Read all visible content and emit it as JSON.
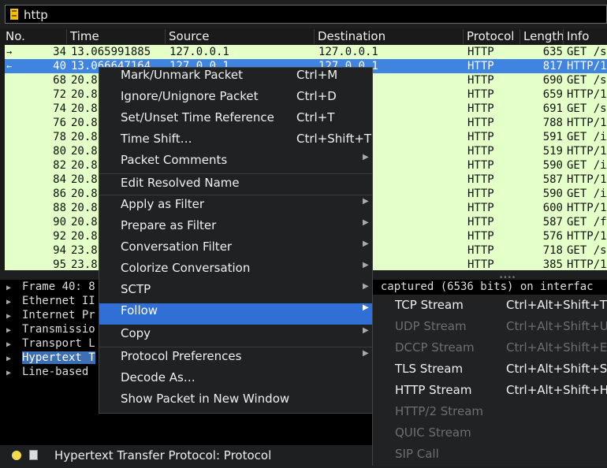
{
  "filter": {
    "value": "http",
    "icon": "bookmark-icon"
  },
  "columns": [
    "No.",
    "Time",
    "Source",
    "Destination",
    "Protocol",
    "Length",
    "Info"
  ],
  "packets": [
    {
      "no": "34",
      "time": "13.065991885",
      "src": "127.0.0.1",
      "dst": "127.0.0.1",
      "proto": "HTTP",
      "len": "635",
      "info": "GET /s"
    },
    {
      "no": "40",
      "time": "13.066647164",
      "src": "127.0.0.1",
      "dst": "127.0.0.1",
      "proto": "HTTP",
      "len": "817",
      "info": "HTTP/1"
    },
    {
      "no": "68",
      "time": "20.8",
      "src": "",
      "dst": "1",
      "proto": "HTTP",
      "len": "690",
      "info": "GET /s"
    },
    {
      "no": "72",
      "time": "20.8",
      "src": "",
      "dst": "1",
      "proto": "HTTP",
      "len": "659",
      "info": "HTTP/1"
    },
    {
      "no": "74",
      "time": "20.8",
      "src": "",
      "dst": "1",
      "proto": "HTTP",
      "len": "691",
      "info": "GET /s"
    },
    {
      "no": "76",
      "time": "20.8",
      "src": "",
      "dst": "1",
      "proto": "HTTP",
      "len": "788",
      "info": "HTTP/1"
    },
    {
      "no": "78",
      "time": "20.8",
      "src": "",
      "dst": "1",
      "proto": "HTTP",
      "len": "591",
      "info": "GET /i"
    },
    {
      "no": "80",
      "time": "20.8",
      "src": "",
      "dst": "1",
      "proto": "HTTP",
      "len": "519",
      "info": "HTTP/1"
    },
    {
      "no": "82",
      "time": "20.8",
      "src": "",
      "dst": "1",
      "proto": "HTTP",
      "len": "590",
      "info": "GET /i"
    },
    {
      "no": "84",
      "time": "20.8",
      "src": "",
      "dst": "1",
      "proto": "HTTP",
      "len": "587",
      "info": "HTTP/1"
    },
    {
      "no": "86",
      "time": "20.8",
      "src": "",
      "dst": "1",
      "proto": "HTTP",
      "len": "590",
      "info": "GET /i"
    },
    {
      "no": "88",
      "time": "20.8",
      "src": "",
      "dst": "1",
      "proto": "HTTP",
      "len": "600",
      "info": "HTTP/1"
    },
    {
      "no": "90",
      "time": "20.8",
      "src": "",
      "dst": "1",
      "proto": "HTTP",
      "len": "587",
      "info": "GET /f"
    },
    {
      "no": "92",
      "time": "20.8",
      "src": "",
      "dst": "1",
      "proto": "HTTP",
      "len": "576",
      "info": "HTTP/1"
    },
    {
      "no": "94",
      "time": "23.8",
      "src": "",
      "dst": "1",
      "proto": "HTTP",
      "len": "718",
      "info": "GET /s"
    },
    {
      "no": "95",
      "time": "23.8",
      "src": "",
      "dst": "1",
      "proto": "HTTP",
      "len": "385",
      "info": "HTTP/1"
    }
  ],
  "details": [
    {
      "text": "Frame 40: 8",
      "tail": "s captured (6536 bits) on interfac"
    },
    {
      "text": "Ethernet II",
      "tail": ""
    },
    {
      "text": "Internet Pr",
      "tail": ""
    },
    {
      "text": "Transmissio",
      "tail": ""
    },
    {
      "text": "Transport L",
      "tail": ""
    },
    {
      "text": "Hypertext T",
      "tail": ""
    },
    {
      "text": "Line-based",
      "tail": ""
    }
  ],
  "context_menu": [
    {
      "label": "Mark/Unmark Packet",
      "shortcut": "Ctrl+M",
      "submenu": false
    },
    {
      "label": "Ignore/Unignore Packet",
      "shortcut": "Ctrl+D",
      "submenu": false
    },
    {
      "label": "Set/Unset Time Reference",
      "shortcut": "Ctrl+T",
      "submenu": false
    },
    {
      "label": "Time Shift…",
      "shortcut": "Ctrl+Shift+T",
      "submenu": false
    },
    {
      "label": "Packet Comments",
      "shortcut": "",
      "submenu": true
    },
    {
      "label": "Edit Resolved Name",
      "shortcut": "",
      "submenu": false
    },
    {
      "label": "Apply as Filter",
      "shortcut": "",
      "submenu": true
    },
    {
      "label": "Prepare as Filter",
      "shortcut": "",
      "submenu": true
    },
    {
      "label": "Conversation Filter",
      "shortcut": "",
      "submenu": true
    },
    {
      "label": "Colorize Conversation",
      "shortcut": "",
      "submenu": true
    },
    {
      "label": "SCTP",
      "shortcut": "",
      "submenu": true
    },
    {
      "label": "Follow",
      "shortcut": "",
      "submenu": true,
      "active": true
    },
    {
      "label": "Copy",
      "shortcut": "",
      "submenu": true
    },
    {
      "label": "Protocol Preferences",
      "shortcut": "",
      "submenu": true
    },
    {
      "label": "Decode As…",
      "shortcut": "",
      "submenu": false
    },
    {
      "label": "Show Packet in New Window",
      "shortcut": "",
      "submenu": false
    }
  ],
  "follow_submenu": [
    {
      "label": "TCP Stream",
      "shortcut": "Ctrl+Alt+Shift+T",
      "enabled": true
    },
    {
      "label": "UDP Stream",
      "shortcut": "Ctrl+Alt+Shift+U",
      "enabled": false
    },
    {
      "label": "DCCP Stream",
      "shortcut": "Ctrl+Alt+Shift+E",
      "enabled": false
    },
    {
      "label": "TLS Stream",
      "shortcut": "Ctrl+Alt+Shift+S",
      "enabled": true
    },
    {
      "label": "HTTP Stream",
      "shortcut": "Ctrl+Alt+Shift+H",
      "enabled": true
    },
    {
      "label": "HTTP/2 Stream",
      "shortcut": "",
      "enabled": false
    },
    {
      "label": "QUIC Stream",
      "shortcut": "",
      "enabled": false
    },
    {
      "label": "SIP Call",
      "shortcut": "",
      "enabled": false
    }
  ],
  "status": {
    "text": "Hypertext Transfer Protocol: Protocol"
  },
  "colors": {
    "row_bg": "#e4ffc7",
    "selected_row": "#3f84e0",
    "menu_active": "#2f6fd6"
  }
}
